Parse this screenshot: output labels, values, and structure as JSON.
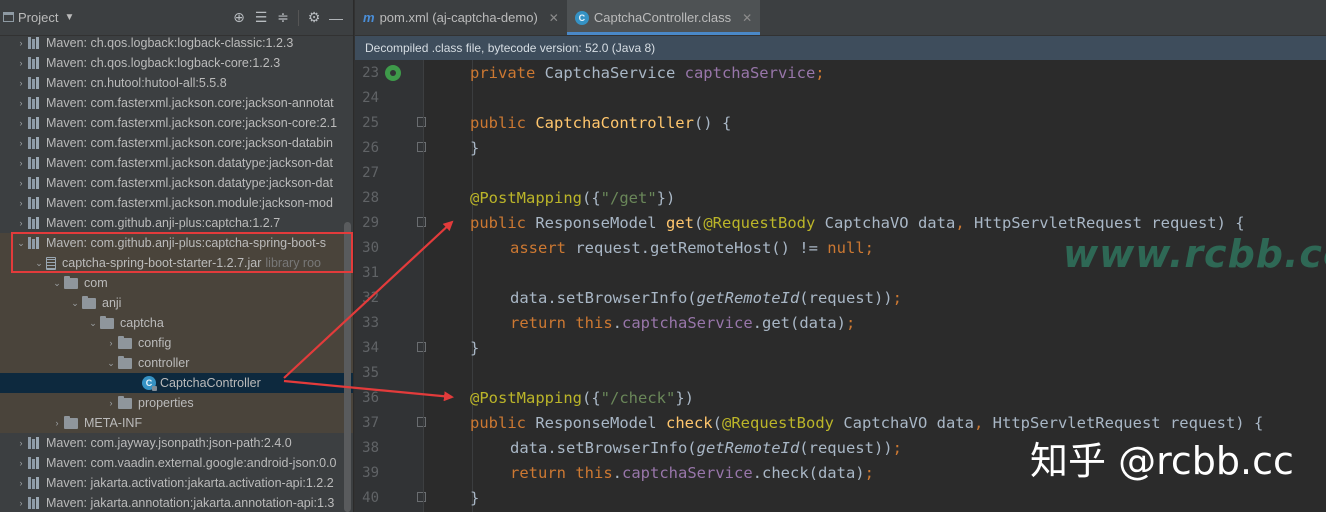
{
  "project_panel": {
    "title": "Project",
    "tree": [
      {
        "label": "Maven: ch.qos.logback:logback-classic:1.2.3",
        "muted": ""
      },
      {
        "label": "Maven: ch.qos.logback:logback-core:1.2.3",
        "muted": ""
      },
      {
        "label": "Maven: cn.hutool:hutool-all:5.5.8",
        "muted": ""
      },
      {
        "label": "Maven: com.fasterxml.jackson.core:jackson-annotat",
        "muted": ""
      },
      {
        "label": "Maven: com.fasterxml.jackson.core:jackson-core:2.1",
        "muted": ""
      },
      {
        "label": "Maven: com.fasterxml.jackson.core:jackson-databin",
        "muted": ""
      },
      {
        "label": "Maven: com.fasterxml.jackson.datatype:jackson-dat",
        "muted": ""
      },
      {
        "label": "Maven: com.fasterxml.jackson.datatype:jackson-dat",
        "muted": ""
      },
      {
        "label": "Maven: com.fasterxml.jackson.module:jackson-mod",
        "muted": ""
      },
      {
        "label": "Maven: com.github.anji-plus:captcha:1.2.7",
        "muted": ""
      },
      {
        "label": "Maven: com.github.anji-plus:captcha-spring-boot-s",
        "muted": ""
      },
      {
        "label": "captcha-spring-boot-starter-1.2.7.jar",
        "muted": "library roo"
      },
      {
        "label": "com",
        "muted": ""
      },
      {
        "label": "anji",
        "muted": ""
      },
      {
        "label": "captcha",
        "muted": ""
      },
      {
        "label": "config",
        "muted": ""
      },
      {
        "label": "controller",
        "muted": ""
      },
      {
        "label": "CaptchaController",
        "muted": ""
      },
      {
        "label": "properties",
        "muted": ""
      },
      {
        "label": "META-INF",
        "muted": ""
      },
      {
        "label": "Maven: com.jayway.jsonpath:json-path:2.4.0",
        "muted": ""
      },
      {
        "label": "Maven: com.vaadin.external.google:android-json:0.0",
        "muted": ""
      },
      {
        "label": "Maven: jakarta.activation:jakarta.activation-api:1.2.2",
        "muted": ""
      },
      {
        "label": "Maven: jakarta.annotation:jakarta.annotation-api:1.3",
        "muted": ""
      }
    ]
  },
  "tabs": [
    {
      "label": "pom.xml (aj-captcha-demo)",
      "icon": "maven-m-icon",
      "active": false
    },
    {
      "label": "CaptchaController.class",
      "icon": "class-icon",
      "active": true
    }
  ],
  "banner": "Decompiled .class file, bytecode version: 52.0 (Java 8)",
  "line_numbers": [
    "23",
    "24",
    "25",
    "26",
    "27",
    "28",
    "29",
    "30",
    "31",
    "32",
    "33",
    "34",
    "35",
    "36",
    "37",
    "38",
    "39",
    "40"
  ],
  "code": {
    "l23_kw": "private ",
    "l23_type": "CaptchaService ",
    "l23_field": "captchaService",
    "l23_end": ";",
    "l25_kw": "public ",
    "l25_fn": "CaptchaController",
    "l25_end": "() {",
    "l26": "}",
    "l28_an": "@PostMapping",
    "l28_p1": "({",
    "l28_str": "\"/get\"",
    "l28_p2": "})",
    "l29_kw": "public ",
    "l29_type": "ResponseModel ",
    "l29_fn": "get",
    "l29_p": "(",
    "l29_an": "@RequestBody ",
    "l29_rest1": "CaptchaVO data",
    "l29_comma": ", ",
    "l29_rest2": "HttpServletRequest request) {",
    "l30_kw": "assert ",
    "l30_mid": "request.getRemoteHost() != ",
    "l30_null": "null",
    "l30_end": ";",
    "l32_a": "data.setBrowserInfo(",
    "l32_it": "getRemoteId",
    "l32_b": "(request))",
    "l32_end": ";",
    "l33_kw": "return this",
    "l33_dot": ".",
    "l33_fd": "captchaService",
    "l33_rest": ".get(data)",
    "l33_end": ";",
    "l34": "}",
    "l36_an": "@PostMapping",
    "l36_p1": "({",
    "l36_str": "\"/check\"",
    "l36_p2": "})",
    "l37_kw": "public ",
    "l37_type": "ResponseModel ",
    "l37_fn": "check",
    "l37_p": "(",
    "l37_an": "@RequestBody ",
    "l37_rest1": "CaptchaVO data",
    "l37_comma": ", ",
    "l37_rest2": "HttpServletRequest request) {",
    "l38_a": "data.setBrowserInfo(",
    "l38_it": "getRemoteId",
    "l38_b": "(request))",
    "l38_end": ";",
    "l39_kw": "return this",
    "l39_dot": ".",
    "l39_fd": "captchaService",
    "l39_rest": ".check(data)",
    "l39_end": ";",
    "l40": "}"
  },
  "watermarks": {
    "site": "www.rcbb.cc",
    "zhihu": "知乎 @rcbb.cc"
  },
  "colors": {
    "annotation_red": "#e33b3b",
    "keyword": "#cc7832",
    "annotation": "#bbb529",
    "string": "#6a8759",
    "selection": "#0d293e"
  }
}
